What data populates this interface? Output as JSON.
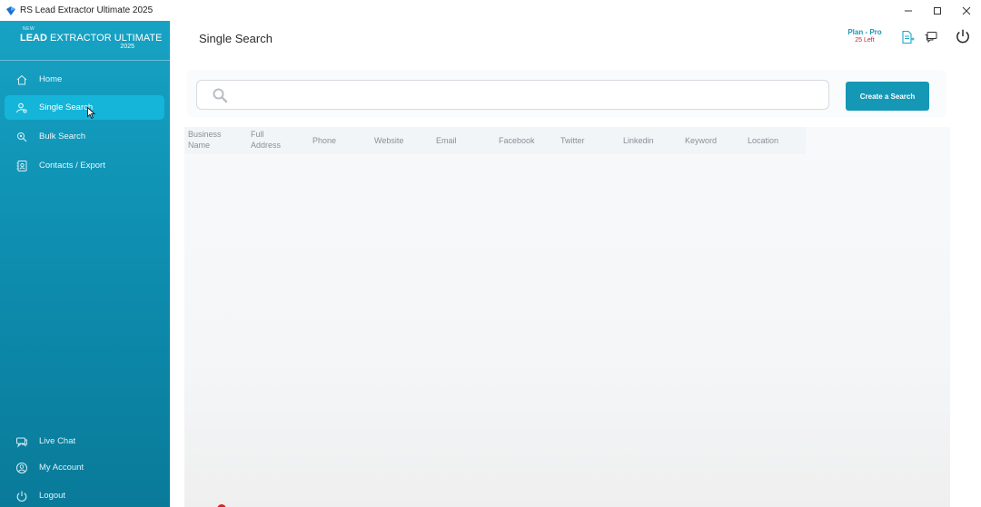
{
  "window": {
    "title": "RS Lead Extractor Ultimate 2025",
    "controls": [
      "minimize-icon",
      "maximize-icon",
      "close-icon"
    ]
  },
  "logo": {
    "new": "NEW",
    "lead": "LEAD",
    "rest": "EXTRACTOR ULTIMATE",
    "year": "2025"
  },
  "sidebar": {
    "items": [
      {
        "label": "Home",
        "icon": "home-icon"
      },
      {
        "label": "Single Search",
        "icon": "user-search-icon",
        "active": true
      },
      {
        "label": "Bulk Search",
        "icon": "bulk-search-icon"
      },
      {
        "label": "Contacts / Export",
        "icon": "contacts-icon"
      }
    ],
    "bottom": [
      {
        "label": "Live Chat",
        "icon": "chat-icon"
      },
      {
        "label": "My Account",
        "icon": "account-icon"
      },
      {
        "label": "Logout",
        "icon": "power-icon"
      }
    ]
  },
  "header": {
    "page_title": "Single Search",
    "plan_name": "Plan - Pro",
    "plan_left": "25 Left"
  },
  "search": {
    "value": "",
    "placeholder": "",
    "button_label": "Create a Search"
  },
  "table": {
    "columns": [
      {
        "line1": "Business",
        "line2": "Name"
      },
      {
        "line1": "Full",
        "line2": "Address"
      },
      {
        "line1": "Phone",
        "line2": ""
      },
      {
        "line1": "Website",
        "line2": ""
      },
      {
        "line1": "Email",
        "line2": ""
      },
      {
        "line1": "Facebook",
        "line2": ""
      },
      {
        "line1": "Twitter",
        "line2": ""
      },
      {
        "line1": "Linkedin",
        "line2": ""
      },
      {
        "line1": "Keyword",
        "line2": ""
      },
      {
        "line1": "Location",
        "line2": ""
      }
    ],
    "rows": []
  },
  "colors": {
    "accent": "#1598b6",
    "sidebar": "#0e8fb1",
    "active_item": "#14b5d8",
    "plan_left": "#c0282d"
  }
}
